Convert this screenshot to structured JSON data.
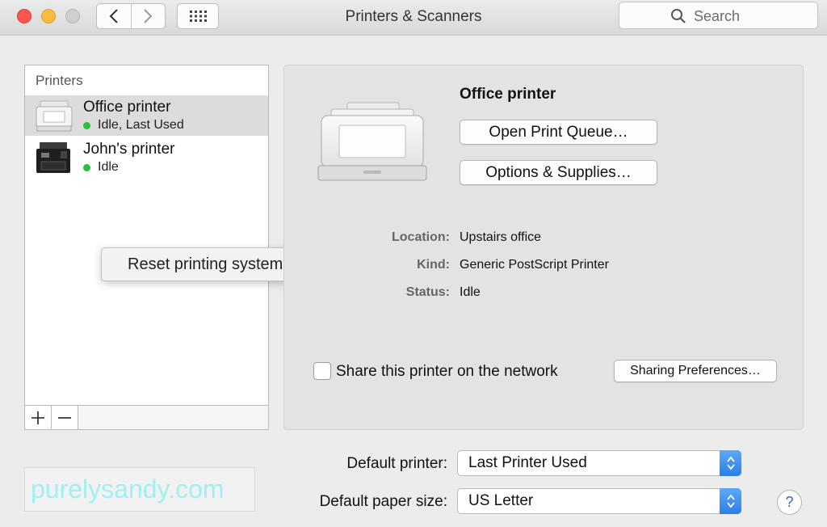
{
  "window": {
    "title": "Printers & Scanners",
    "search_placeholder": "Search"
  },
  "printer_list": {
    "header": "Printers",
    "printers": [
      {
        "name": "Office printer",
        "status": "Idle, Last Used",
        "status_color": "#27c23c",
        "selected": true
      },
      {
        "name": "John's printer",
        "status": "Idle",
        "status_color": "#27c23c",
        "selected": false
      }
    ],
    "add_icon": "plus-icon",
    "remove_icon": "minus-icon"
  },
  "context_menu": {
    "items": [
      "Reset printing system…"
    ]
  },
  "details": {
    "printer_name": "Office printer",
    "open_queue_label": "Open Print Queue…",
    "options_label": "Options & Supplies…",
    "location_label": "Location:",
    "location_value": "Upstairs office",
    "kind_label": "Kind:",
    "kind_value": "Generic PostScript Printer",
    "status_label": "Status:",
    "status_value": "Idle",
    "share_label": "Share this printer on the network",
    "share_checked": false,
    "sharing_prefs_label": "Sharing Preferences…"
  },
  "defaults": {
    "default_printer_label": "Default printer:",
    "default_printer_value": "Last Printer Used",
    "paper_size_label": "Default paper size:",
    "paper_size_value": "US Letter"
  },
  "help_label": "?",
  "watermark": "purelysandy.com"
}
